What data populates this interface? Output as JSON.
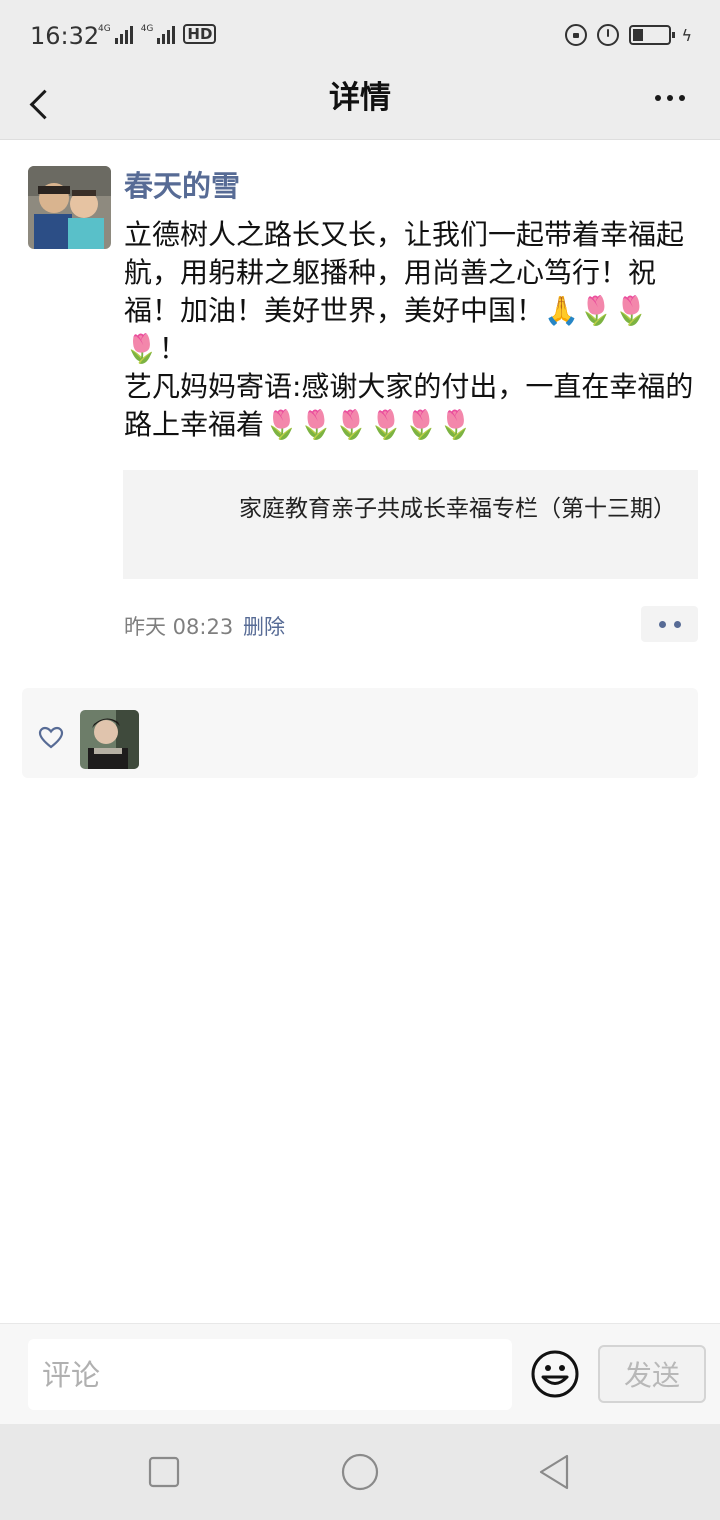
{
  "status_bar": {
    "time": "16:32",
    "network_1": "4G",
    "network_2": "4G",
    "hd_label": "HD"
  },
  "nav": {
    "title": "详情"
  },
  "post": {
    "author": "春天的雪",
    "text_line_1": "立德树人之路长又长，让我们一起带着幸福起航，用躬耕之躯播种，用尚善之心笃行！祝福！加油！美好世界，美好中国！",
    "emoji_pray": "🙏",
    "emoji_tulip": "🌷",
    "text_exclaim": "！",
    "text_line_2": "艺凡妈妈寄语:感谢大家的付出，一直在幸福的路上幸福着",
    "link_title": "家庭教育亲子共成长幸福专栏（第十三期）",
    "time": "昨天 08:23",
    "delete_label": "删除"
  },
  "comment": {
    "placeholder": "评论",
    "send_label": "发送"
  },
  "colors": {
    "link_blue": "#576b95",
    "bar_gray": "#ededed"
  }
}
